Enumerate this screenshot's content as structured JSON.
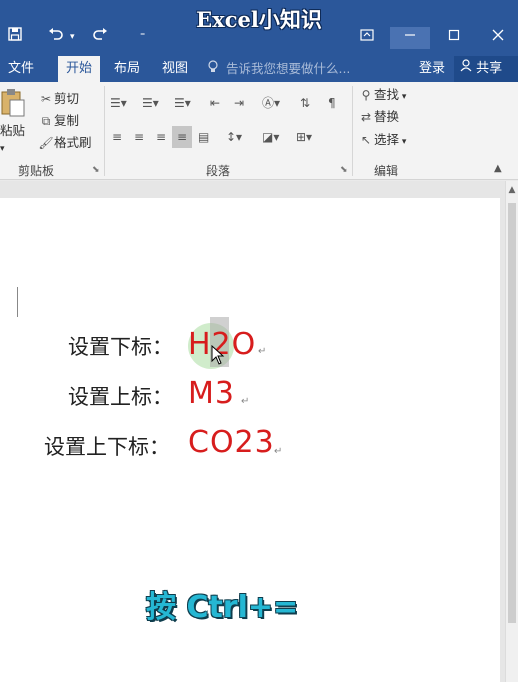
{
  "window": {
    "title": "Excel小知识",
    "quick_access": {
      "save_icon": "save-icon",
      "undo_icon": "undo-icon",
      "redo_icon": "redo-icon",
      "customize_icon": "customize-icon"
    },
    "controls": [
      "ribbon-display-icon",
      "minimize-icon",
      "maximize-icon",
      "close-icon"
    ]
  },
  "tabs": {
    "file": "文件",
    "home": "开始",
    "layout": "布局",
    "view": "视图",
    "tell_me": "告诉我您想要做什么...",
    "sign_in": "登录",
    "share": "共享"
  },
  "ribbon": {
    "clipboard": {
      "paste": "粘贴",
      "cut": "剪切",
      "copy": "复制",
      "format_painter": "格式刷",
      "group_label": "剪贴板"
    },
    "paragraph": {
      "group_label": "段落"
    },
    "editing": {
      "find": "查找",
      "replace": "替换",
      "select": "选择",
      "group_label": "编辑"
    }
  },
  "document": {
    "lines": [
      {
        "label": "设置下标：",
        "value": "H2O"
      },
      {
        "label": "设置上标：",
        "value": "M3"
      },
      {
        "label": "设置上下标：",
        "value": "CO23"
      }
    ],
    "paragraph_mark": "↵"
  },
  "overlay": {
    "hint": "按 Ctrl+="
  },
  "colors": {
    "title_bar": "#2b579a",
    "value_text": "#d71d1d",
    "hint_text": "#25b7d3"
  }
}
